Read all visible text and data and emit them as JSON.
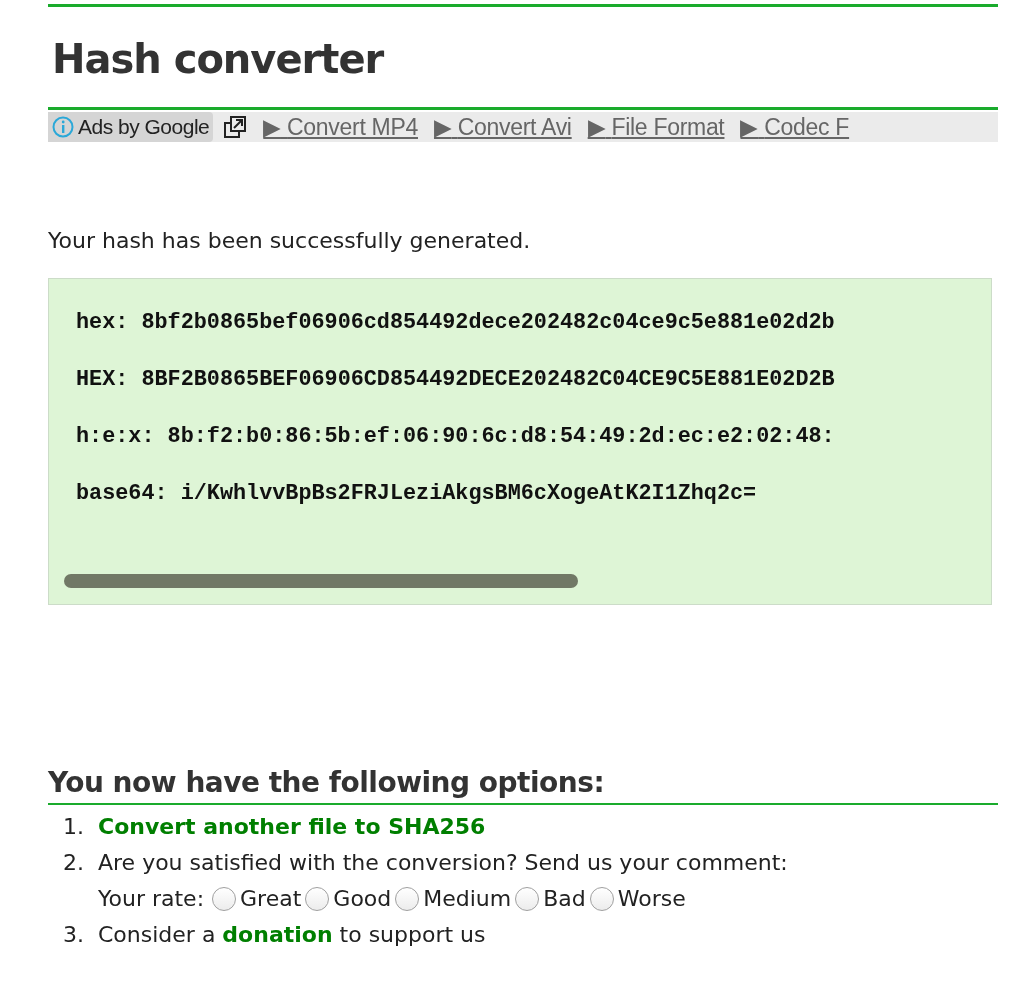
{
  "title": "Hash converter",
  "ads": {
    "label": "Ads by Google",
    "links": [
      {
        "arrow": "▶",
        "label": "Convert MP4"
      },
      {
        "arrow": "▶",
        "label": "Convert Avi"
      },
      {
        "arrow": "▶",
        "label": "File Format"
      },
      {
        "arrow": "▶",
        "label": "Codec F"
      }
    ]
  },
  "message": "Your hash has been successfully generated.",
  "hashes": [
    {
      "label": "hex:",
      "value": "8bf2b0865bef06906cd854492dece202482c04ce9c5e881e02d2b"
    },
    {
      "label": "HEX:",
      "value": "8BF2B0865BEF06906CD854492DECE202482C04CE9C5E881E02D2B"
    },
    {
      "label": "h:e:x:",
      "value": "8b:f2:b0:86:5b:ef:06:90:6c:d8:54:49:2d:ec:e2:02:48:"
    },
    {
      "label": "base64:",
      "value": "i/KwhlvvBpBs2FRJLeziAkgsBM6cXogeAtK2I1Zhq2c="
    }
  ],
  "options_heading": "You now have the following options:",
  "options": [
    {
      "kind": "link",
      "number": "1.",
      "text": "Convert another file to SHA256"
    },
    {
      "kind": "rating",
      "number": "2.",
      "text": "Are you satisfied with the conversion? Send us your comment:",
      "rate_label": "Your rate:",
      "choices": [
        {
          "label": "Great",
          "selected": false
        },
        {
          "label": "Good",
          "selected": false
        },
        {
          "label": "Medium",
          "selected": false
        },
        {
          "label": "Bad",
          "selected": false
        },
        {
          "label": "Worse",
          "selected": false
        }
      ]
    },
    {
      "kind": "donation",
      "number": "3.",
      "before": "Consider a ",
      "link": "donation",
      "after": " to support us"
    }
  ]
}
